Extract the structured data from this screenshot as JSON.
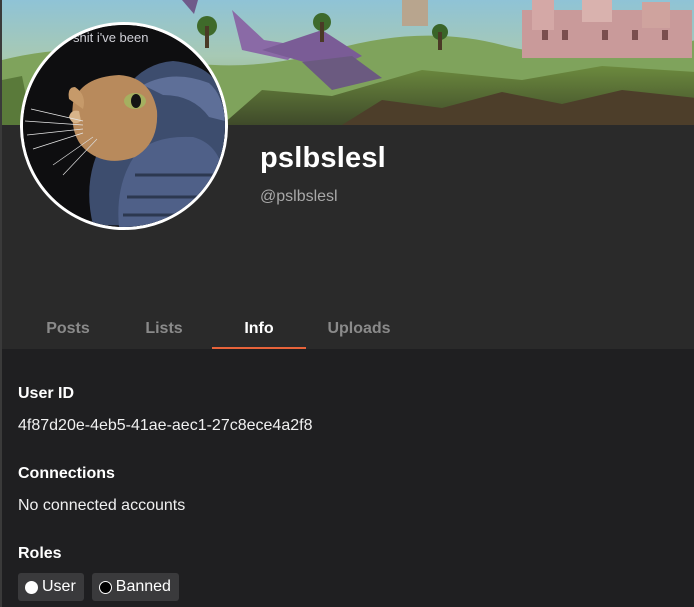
{
  "profile": {
    "display_name": "pslbslesl",
    "handle": "@pslbslesl",
    "avatar_caption": "shit i've been",
    "banner_icon": "fantasy-landscape-banner",
    "avatar_icon": "cat-in-puffer-jacket-avatar"
  },
  "tabs": [
    {
      "label": "Posts",
      "active": false
    },
    {
      "label": "Lists",
      "active": false
    },
    {
      "label": "Info",
      "active": true
    },
    {
      "label": "Uploads",
      "active": false
    }
  ],
  "info": {
    "user_id": {
      "title": "User ID",
      "value": "4f87d20e-4eb5-41ae-aec1-27c8ece4a2f8"
    },
    "connections": {
      "title": "Connections",
      "value": "No connected accounts"
    },
    "roles": {
      "title": "Roles",
      "items": [
        {
          "label": "User",
          "dot": "filled"
        },
        {
          "label": "Banned",
          "dot": "hollow"
        }
      ]
    }
  },
  "colors": {
    "accent": "#e8633a",
    "header_bg": "#2a2a2a",
    "content_bg": "#1f1f21",
    "chip_bg": "#3a3a3c"
  }
}
